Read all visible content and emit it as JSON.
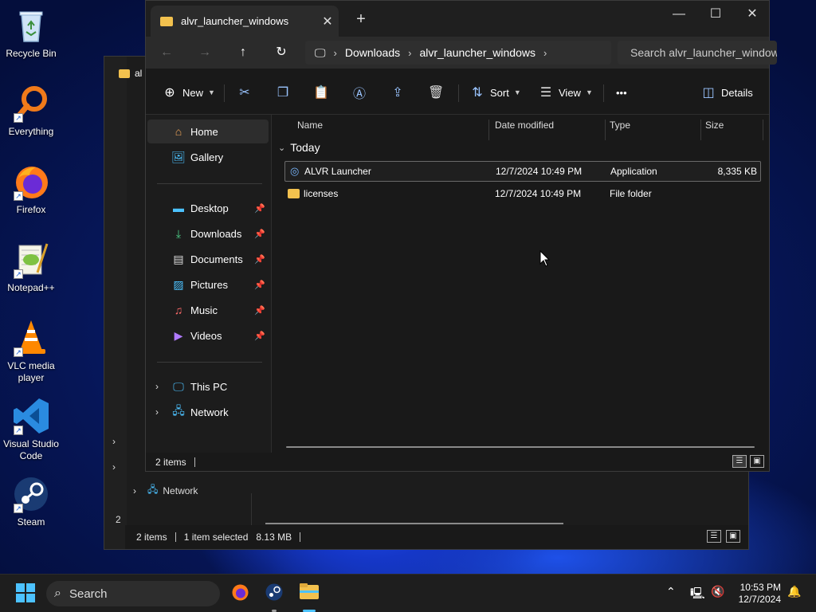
{
  "desktop": {
    "icons": [
      {
        "label": "Recycle Bin",
        "icon": "recycle-bin-icon"
      },
      {
        "label": "Everything",
        "icon": "everything-search-icon"
      },
      {
        "label": "Firefox",
        "icon": "firefox-icon"
      },
      {
        "label": "Notepad++",
        "icon": "notepad-plus-plus-icon"
      },
      {
        "label": "VLC media player",
        "icon": "vlc-icon"
      },
      {
        "label": "Visual Studio Code",
        "icon": "vscode-icon"
      },
      {
        "label": "Steam",
        "icon": "steam-icon"
      }
    ]
  },
  "back_window": {
    "tab_fragment": "al",
    "status_fragment": "2",
    "nav_network": "Network",
    "status_items": "2 items",
    "status_selected": "1 item selected",
    "status_size": "8.13 MB"
  },
  "window": {
    "tab_title": "alvr_launcher_windows",
    "new_tab": "+",
    "breadcrumb": [
      "Downloads",
      "alvr_launcher_windows"
    ],
    "search_placeholder": "Search alvr_launcher_windows",
    "toolbar": {
      "new_label": "New",
      "sort_label": "Sort",
      "view_label": "View",
      "more_label": "•••",
      "details_label": "Details"
    },
    "sidebar": {
      "home": "Home",
      "gallery": "Gallery",
      "desktop": "Desktop",
      "downloads": "Downloads",
      "documents": "Documents",
      "pictures": "Pictures",
      "music": "Music",
      "videos": "Videos",
      "this_pc": "This PC",
      "network": "Network"
    },
    "columns": {
      "name": "Name",
      "date": "Date modified",
      "type": "Type",
      "size": "Size"
    },
    "group_label": "Today",
    "files": [
      {
        "name": "ALVR Launcher",
        "date": "12/7/2024 10:49 PM",
        "type": "Application",
        "size": "8,335 KB",
        "icon": "application-icon",
        "selected": true
      },
      {
        "name": "licenses",
        "date": "12/7/2024 10:49 PM",
        "type": "File folder",
        "size": "",
        "icon": "folder-icon",
        "selected": false
      }
    ],
    "status_items": "2 items"
  },
  "taskbar": {
    "search_label": "Search",
    "time": "10:53 PM",
    "date": "12/7/2024"
  },
  "colors": {
    "accent": "#4cc2ff",
    "folder": "#f2c14e",
    "window_bg": "#191919"
  }
}
